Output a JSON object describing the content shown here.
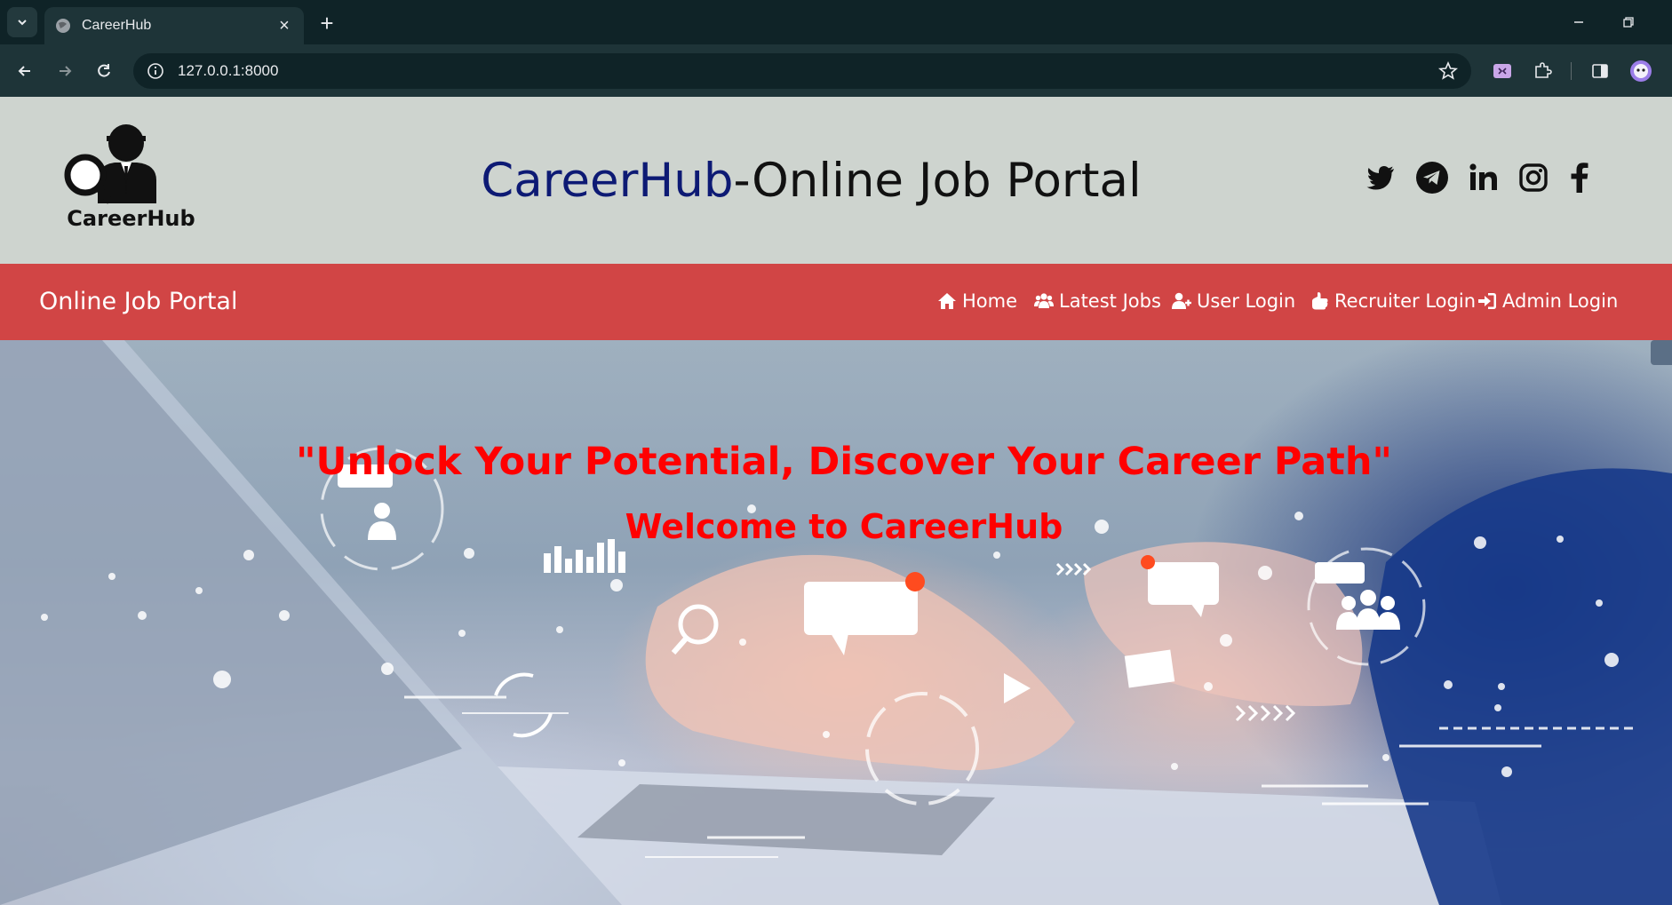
{
  "browser": {
    "tab_title": "CareerHub",
    "url": "127.0.0.1:8000"
  },
  "header": {
    "logo_text": "CareerHub",
    "title_brand": "CareerHub",
    "title_rest": "-Online Job Portal",
    "social": [
      "twitter-icon",
      "telegram-icon",
      "linkedin-icon",
      "instagram-icon",
      "facebook-icon"
    ]
  },
  "navbar": {
    "brand": "Online Job Portal",
    "links": [
      {
        "label": "Home",
        "icon": "home-icon"
      },
      {
        "label": "Latest Jobs",
        "icon": "users-icon"
      },
      {
        "label": "User Login",
        "icon": "user-plus-icon"
      },
      {
        "label": "Recruiter Login",
        "icon": "handshake-icon"
      },
      {
        "label": "Admin Login",
        "icon": "sign-in-icon"
      }
    ]
  },
  "hero": {
    "quote": "\"Unlock Your Potential, Discover Your Career Path\"",
    "welcome": "Welcome to CareerHub"
  },
  "colors": {
    "header_bg": "#ced4cf",
    "navbar_bg": "#d14545",
    "brand_blue": "#0d1a74",
    "hero_text": "#ff0000"
  }
}
